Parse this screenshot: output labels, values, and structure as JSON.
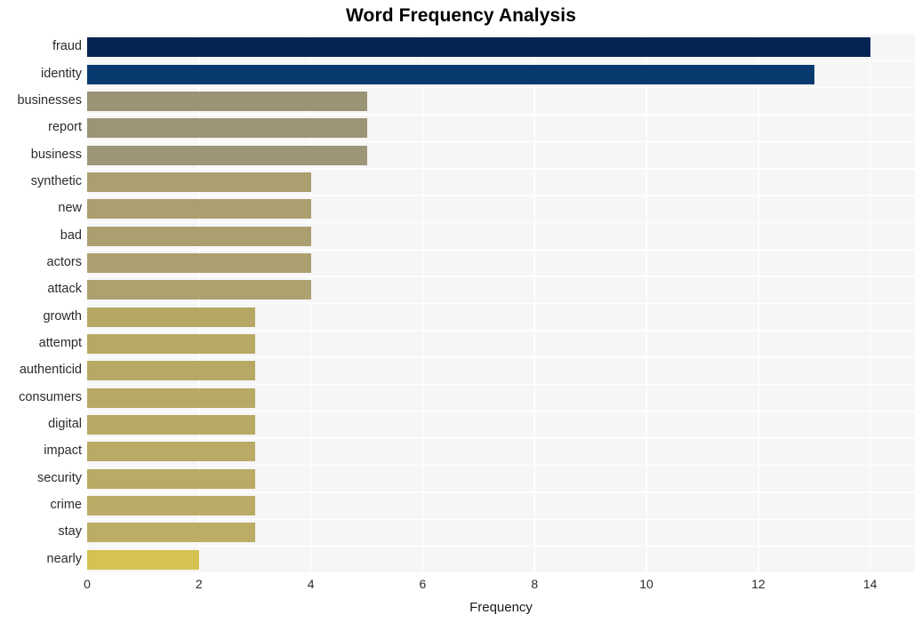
{
  "chart_data": {
    "type": "bar",
    "orientation": "horizontal",
    "title": "Word Frequency Analysis",
    "xlabel": "Frequency",
    "ylabel": "",
    "categories": [
      "fraud",
      "identity",
      "businesses",
      "report",
      "business",
      "synthetic",
      "new",
      "bad",
      "actors",
      "attack",
      "growth",
      "attempt",
      "authenticid",
      "consumers",
      "digital",
      "impact",
      "security",
      "crime",
      "stay",
      "nearly"
    ],
    "values": [
      14,
      13,
      5,
      5,
      5,
      4,
      4,
      4,
      4,
      4,
      3,
      3,
      3,
      3,
      3,
      3,
      3,
      3,
      3,
      2
    ],
    "xlim": [
      0,
      14.8
    ],
    "xticks": [
      0,
      2,
      4,
      6,
      8,
      10,
      12,
      14
    ],
    "xtick_labels": [
      "0",
      "2",
      "4",
      "6",
      "8",
      "10",
      "12",
      "14"
    ],
    "grid": true,
    "grid_color": "#ffffff",
    "legend": "none",
    "plot_background": "#f6f6f7",
    "figure_background": "#ffffff",
    "colormap": "cividis",
    "bar_colors": [
      "#042551",
      "#083a70",
      "#9b9376",
      "#9c9476",
      "#9d9577",
      "#ab9f6f",
      "#ac9f6f",
      "#ac9f6f",
      "#ada070",
      "#aea170",
      "#b6a764",
      "#b7a864",
      "#b7a864",
      "#b8a965",
      "#b8a965",
      "#b9aa65",
      "#b9aa65",
      "#baab66",
      "#bbac66",
      "#d5c252"
    ]
  },
  "axes": {
    "x_label": "Frequency"
  }
}
